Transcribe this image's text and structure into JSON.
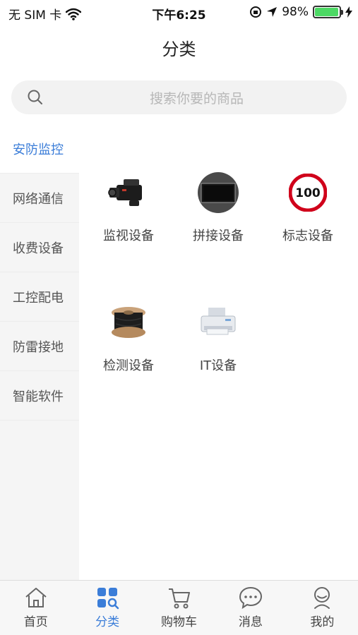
{
  "status_bar": {
    "carrier": "无 SIM 卡",
    "time": "下午6:25",
    "battery_text": "98%",
    "battery_level": 0.98,
    "battery_color": "#4cd964"
  },
  "header": {
    "title": "分类"
  },
  "search": {
    "placeholder": "搜索你要的商品"
  },
  "sidebar": {
    "items": [
      {
        "label": "安防监控",
        "active": true
      },
      {
        "label": "网络通信",
        "active": false
      },
      {
        "label": "收费设备",
        "active": false
      },
      {
        "label": "工控配电",
        "active": false
      },
      {
        "label": "防雷接地",
        "active": false
      },
      {
        "label": "智能软件",
        "active": false
      }
    ]
  },
  "categories": [
    {
      "label": "监视设备",
      "icon": "video-camera-icon"
    },
    {
      "label": "拼接设备",
      "icon": "monitor-icon"
    },
    {
      "label": "标志设备",
      "icon": "speed-limit-sign-icon",
      "sign_text": "100"
    },
    {
      "label": "检测设备",
      "icon": "cable-reel-icon"
    },
    {
      "label": "IT设备",
      "icon": "printer-icon"
    }
  ],
  "tabbar": {
    "tabs": [
      {
        "label": "首页",
        "icon": "home-icon",
        "active": false
      },
      {
        "label": "分类",
        "icon": "category-icon",
        "active": true
      },
      {
        "label": "购物车",
        "icon": "cart-icon",
        "active": false
      },
      {
        "label": "消息",
        "icon": "message-icon",
        "active": false
      },
      {
        "label": "我的",
        "icon": "profile-icon",
        "active": false
      }
    ]
  },
  "colors": {
    "accent": "#3b7dd8",
    "sidebar_bg": "#f5f5f5",
    "search_bg": "#f2f2f2"
  }
}
